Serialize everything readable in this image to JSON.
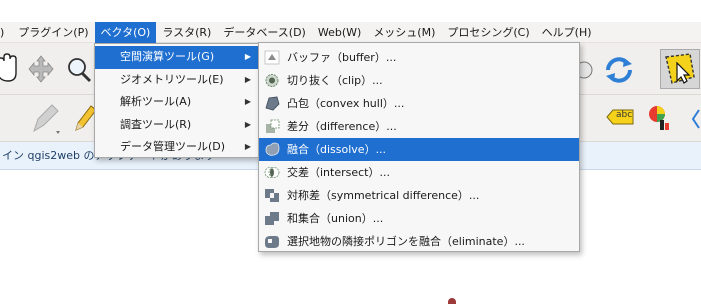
{
  "menubar": {
    "items": [
      {
        "label": ")"
      },
      {
        "label": "プラグイン(P)"
      },
      {
        "label": "ベクタ(O)"
      },
      {
        "label": "ラスタ(R)"
      },
      {
        "label": "データベース(D)"
      },
      {
        "label": "Web(W)"
      },
      {
        "label": "メッシュ(M)"
      },
      {
        "label": "プロセシング(C)"
      },
      {
        "label": "ヘルプ(H)"
      }
    ],
    "active_index": 2
  },
  "vector_menu": {
    "items": [
      {
        "label": "空間演算ツール(G)",
        "active": true
      },
      {
        "label": "ジオメトリツール(E)",
        "active": false
      },
      {
        "label": "解析ツール(A)",
        "active": false
      },
      {
        "label": "調査ツール(R)",
        "active": false
      },
      {
        "label": "データ管理ツール(D)",
        "active": false
      }
    ]
  },
  "geoprocessing_menu": {
    "items": [
      {
        "label": "バッファ（buffer）...",
        "icon": "buffer-icon"
      },
      {
        "label": "切り抜く（clip）...",
        "icon": "clip-icon"
      },
      {
        "label": "凸包（convex hull）...",
        "icon": "convex-hull-icon"
      },
      {
        "label": "差分（difference）...",
        "icon": "difference-icon"
      },
      {
        "label": "融合（dissolve）...",
        "icon": "dissolve-icon",
        "active": true
      },
      {
        "label": "交差（intersect）...",
        "icon": "intersect-icon"
      },
      {
        "label": "対称差（symmetrical difference）...",
        "icon": "symmetrical-difference-icon"
      },
      {
        "label": "和集合（union）...",
        "icon": "union-icon"
      },
      {
        "label": "選択地物の隣接ポリゴンを融合（eliminate）...",
        "icon": "eliminate-icon"
      }
    ]
  },
  "message_bar": {
    "text": "イン qgis2web のアップデートがあります"
  },
  "toolbar": {
    "label_badge": "abc"
  },
  "colors": {
    "accent": "#1f6fd1",
    "menu_bg": "#f7f7f7",
    "toolbar_bg": "#f1efed",
    "message_bg": "#e9f2fb"
  }
}
